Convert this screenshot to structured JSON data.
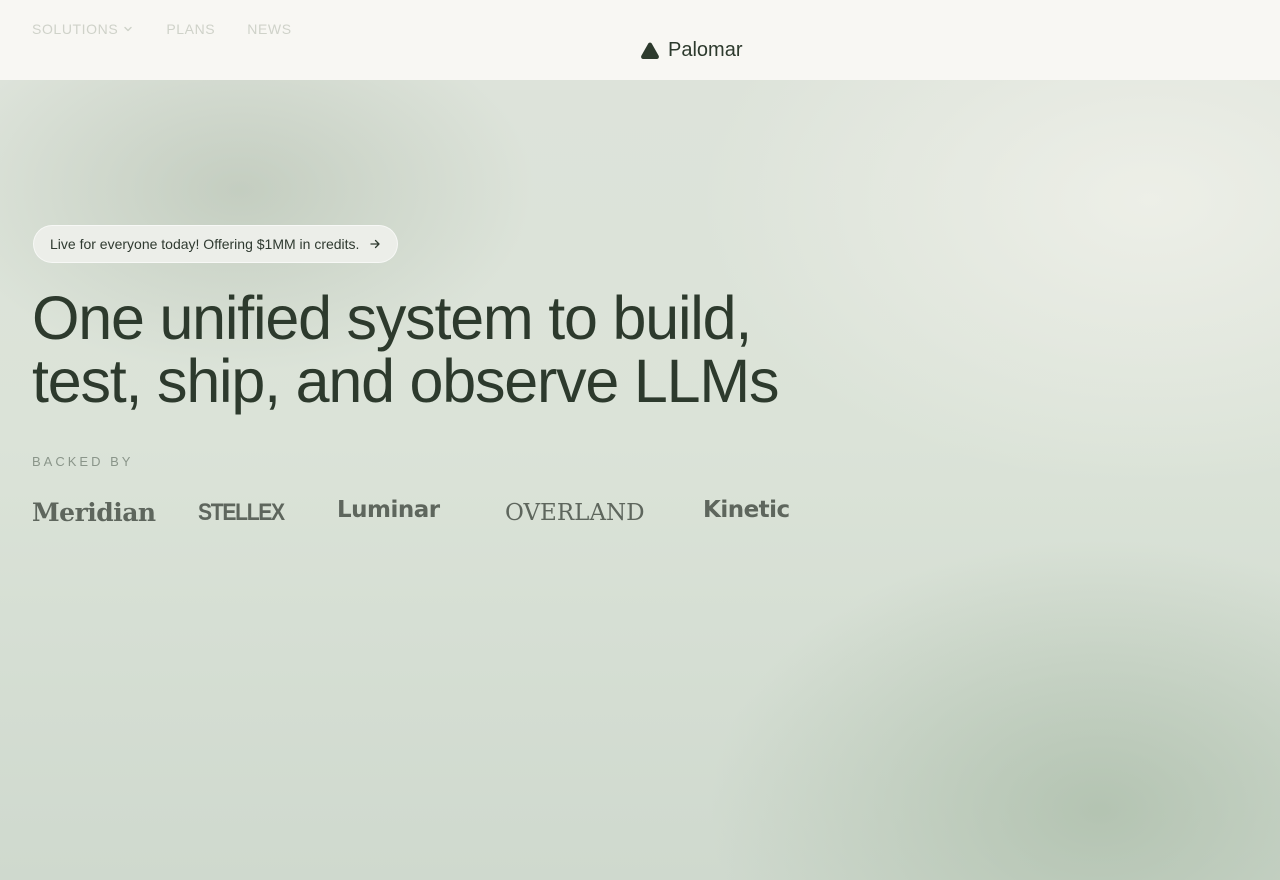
{
  "nav": {
    "items": [
      {
        "label": "SOLUTIONS",
        "icon": "chevron-down-icon"
      },
      {
        "label": "PLANS"
      },
      {
        "label": "NEWS"
      }
    ]
  },
  "brand": {
    "name": "Palomar",
    "icon": "mountain-logo-icon"
  },
  "hero": {
    "announcement": "Live for everyone today! Offering $1MM in credits.",
    "announcement_icon": "arrow-right-icon",
    "headline_line1": "One unified system to build,",
    "headline_line2": "test, ship, and observe LLMs",
    "backed_by_label": "BACKED BY",
    "backers": [
      "Meridian",
      "STELLEX",
      "Luminar",
      "OVERLAND",
      "Kinetic"
    ]
  },
  "colors": {
    "ink": "#2d3a2d",
    "nav_muted": "#cfd2c9",
    "logo_gray": "#5e665d",
    "topbar_bg": "#f8f7f3",
    "pill_bg": "#eceee9"
  }
}
